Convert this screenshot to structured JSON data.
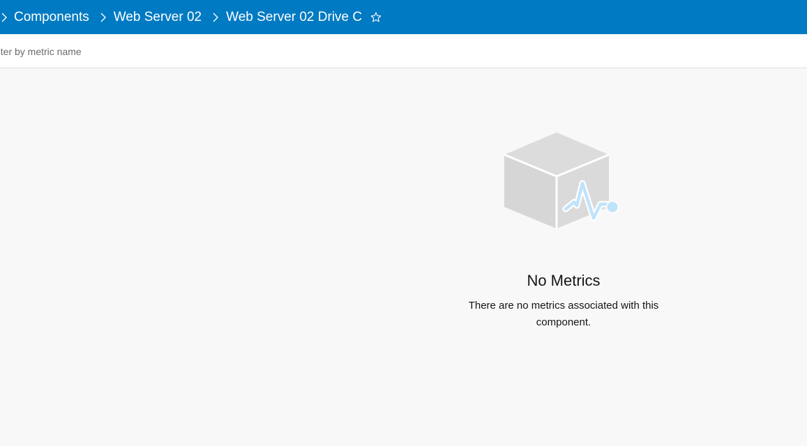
{
  "breadcrumb": {
    "items": [
      {
        "label": "Components"
      },
      {
        "label": "Web Server 02"
      },
      {
        "label": "Web Server 02 Drive C"
      }
    ],
    "favorite_icon": "star-outline-icon",
    "separator_icon": "chevron-right-icon"
  },
  "filter": {
    "placeholder": "Filter by metric name",
    "value": ""
  },
  "empty_state": {
    "icon": "box-with-pulse-icon",
    "title": "No Metrics",
    "description": "There are no metrics associated with this component."
  },
  "colors": {
    "header_bg": "#007ac2",
    "header_text": "#ffffff",
    "page_bg": "#f8f8f8",
    "illustration_gray": "#d9d9d9",
    "illustration_accent": "#bfe3fb"
  }
}
